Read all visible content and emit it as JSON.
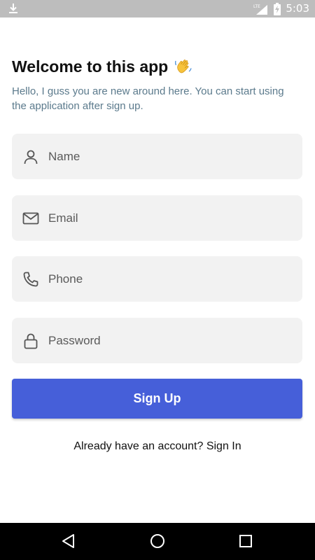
{
  "status_bar": {
    "time": "5:03",
    "network": "LTE",
    "icons": [
      "download-icon",
      "signal-icon",
      "battery-charging-icon"
    ]
  },
  "header": {
    "title": "Welcome to this app",
    "emoji_icon": "waving-hand-icon",
    "subtitle": "Hello, I guss you are new around here. You can start using the application after sign up."
  },
  "form": {
    "fields": [
      {
        "icon": "person-icon",
        "placeholder": "Name",
        "value": ""
      },
      {
        "icon": "mail-icon",
        "placeholder": "Email",
        "value": ""
      },
      {
        "icon": "phone-icon",
        "placeholder": "Phone",
        "value": ""
      },
      {
        "icon": "lock-icon",
        "placeholder": "Password",
        "value": ""
      }
    ],
    "submit_label": "Sign Up"
  },
  "signin": {
    "prompt": "Already have an account?",
    "link": "Sign In"
  },
  "nav": {
    "icons": [
      "back-icon",
      "home-icon",
      "recents-icon"
    ]
  },
  "colors": {
    "primary": "#465fd9",
    "field_bg": "#f2f2f2",
    "subtitle": "#5b7a8c",
    "status_bar": "#bdbdbd"
  }
}
